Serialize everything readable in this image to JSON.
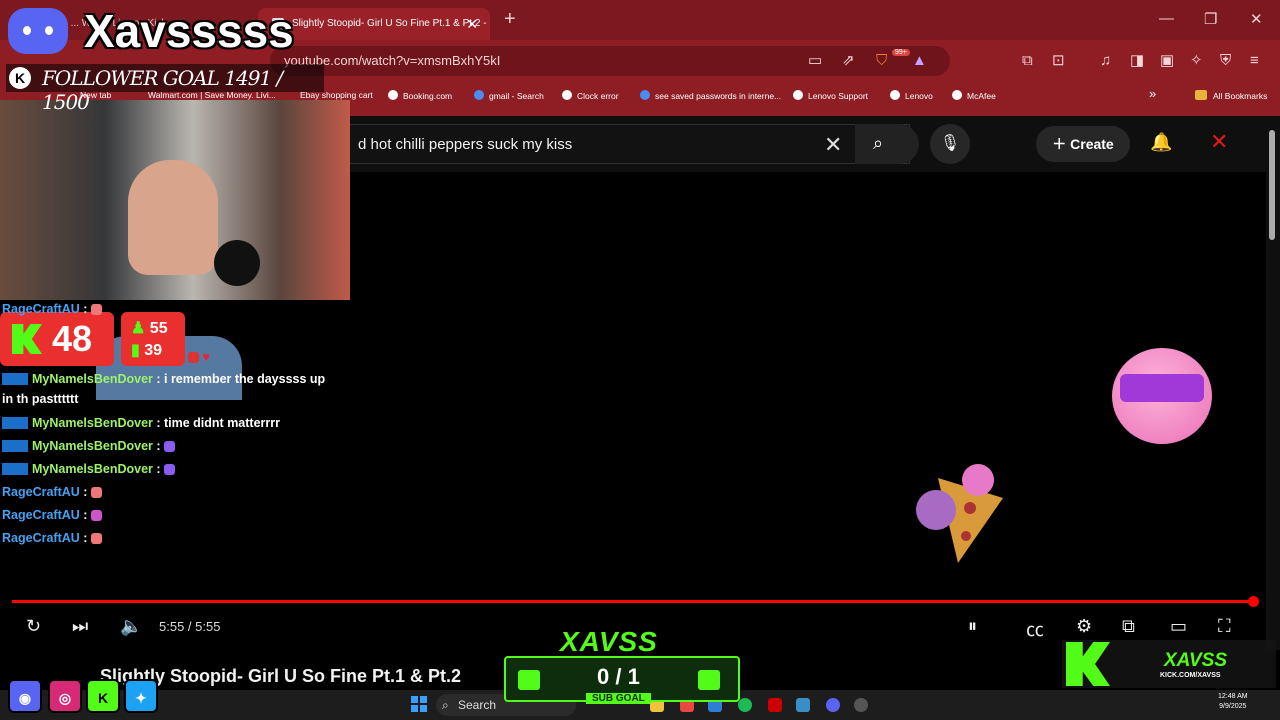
{
  "browser": {
    "tabs": [
      {
        "label": "...isLive ... Watch Live on Kick",
        "active": false
      },
      {
        "label": "Slightly Stoopid- Girl U So Fine Pt.1 & Pt.2 -",
        "active": true
      }
    ],
    "url": "youtube.com/watch?v=xmsmBxhY5kI",
    "extension_badge": "99+",
    "bookmarks": [
      "New tab",
      "Walmart.com | Save Money. Livi...",
      "Ebay shopping cart",
      "Booking.com",
      "gmail - Search",
      "Clock error",
      "see saved passwords in interne...",
      "Lenovo Support",
      "Lenovo",
      "McAfee"
    ],
    "all_bookmarks": "All Bookmarks"
  },
  "youtube": {
    "search_query": "d hot chilli peppers suck my kiss",
    "create_label": "Create",
    "time": "5:55 / 5:55",
    "video_title": "Slightly Stoopid- Girl U So Fine Pt.1 & Pt.2",
    "progress": 1.0
  },
  "overlay": {
    "streamer_name": "Xavsssss",
    "follower_goal": "FOLLOWER GOAL 1491 / 1500",
    "viewers": "48",
    "stat_up": "55",
    "stat_bars": "39",
    "subgoal_title": "XAVSS",
    "subgoal_count": "0 / 1",
    "subgoal_label": "SUB GOAL",
    "kick_name": "XAVSS",
    "kick_url": "KICK.COM/XAVSS",
    "colors": {
      "kick_green": "#53fc18",
      "viewer_red": "#e9302f"
    }
  },
  "chat": [
    {
      "user": "RageCraftAU",
      "msg": ""
    },
    {
      "user": "MyNamelsBenDover",
      "msg": "i remember the dayssss up",
      "cont": "in th pastttttt"
    },
    {
      "user": "MyNamelsBenDover",
      "msg": "time didnt matterrrr"
    },
    {
      "user": "MyNamelsBenDover",
      "msg": ""
    },
    {
      "user": "MyNamelsBenDover",
      "msg": ""
    },
    {
      "user": "RageCraftAU",
      "msg": ""
    },
    {
      "user": "RageCraftAU",
      "msg": ""
    },
    {
      "user": "RageCraftAU",
      "msg": ""
    }
  ],
  "taskbar": {
    "search_label": "Search",
    "time": "12:48 AM",
    "date": "9/9/2025"
  }
}
